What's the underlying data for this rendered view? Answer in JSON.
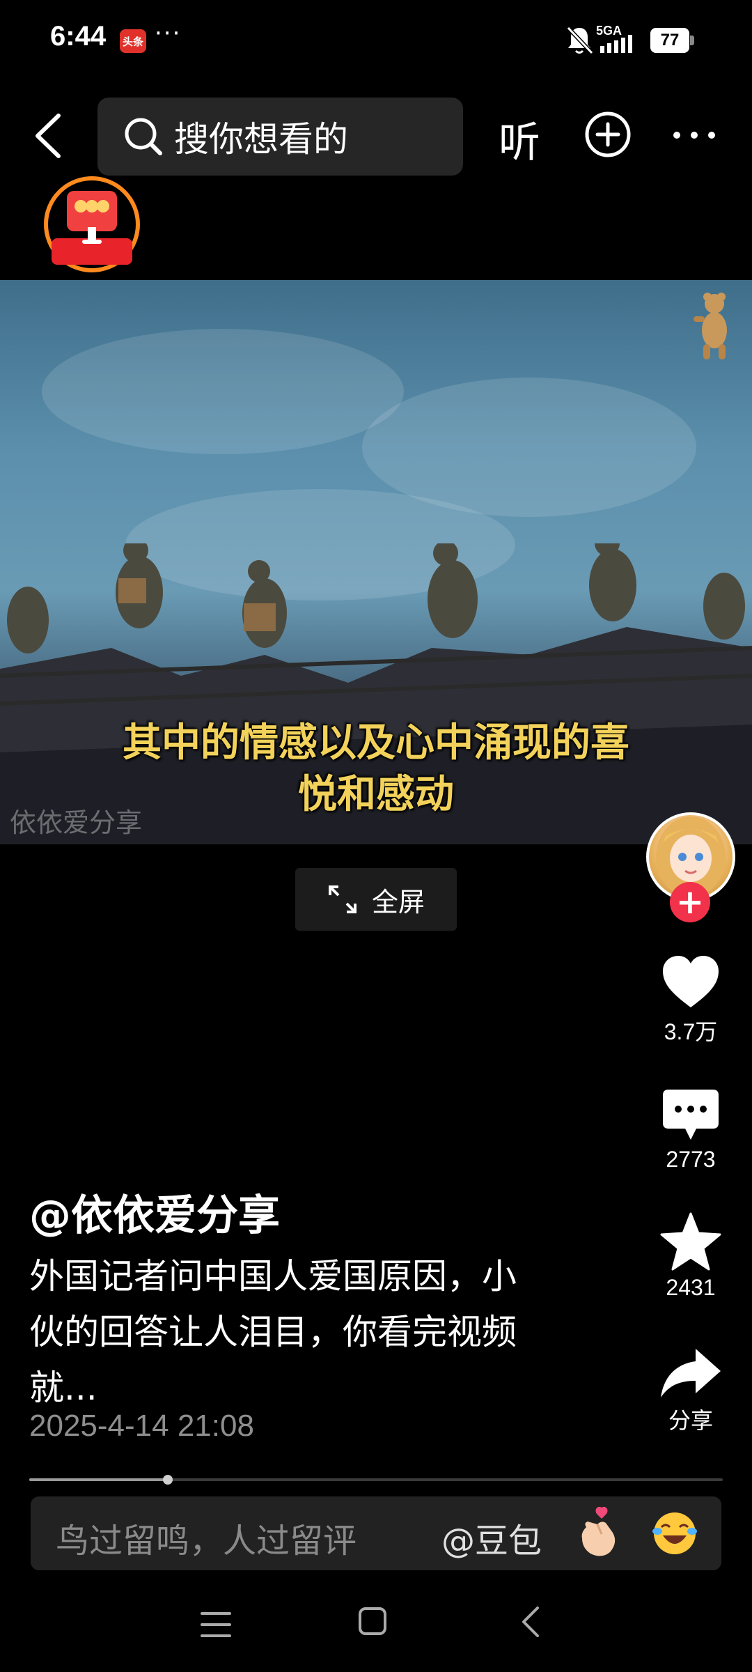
{
  "status_bar": {
    "time": "6:44",
    "app_badge": "头条",
    "overflow_dots": "···",
    "network": "5GA",
    "battery": "77"
  },
  "top_bar": {
    "search_placeholder": "搜你想看的",
    "listen_label": "听"
  },
  "video": {
    "subtitle_line1": "其中的情感以及心中涌现的喜",
    "subtitle_line2": "悦和感动",
    "watermark": "依依爱分享",
    "fullscreen_label": "全屏"
  },
  "actions": {
    "likes": "3.7万",
    "comments": "2773",
    "favorites": "2431",
    "share": "分享"
  },
  "post": {
    "author": "@依依爱分享",
    "caption_line1": "外国记者问中国人爱国原因，小",
    "caption_line2": "伙的回答让人泪目，你看完视频",
    "caption_line3": "就...",
    "time": "2025-4-14 21:08",
    "progress_fraction": 0.2
  },
  "comment_bar": {
    "placeholder": "鸟过留鸣，人过留评",
    "mention": "@豆包"
  },
  "icons": [
    "bell-off-icon",
    "signal-icon",
    "back-icon",
    "search-icon",
    "plus-circle-icon",
    "more-icon",
    "red-envelope-icon",
    "expand-icon",
    "heart-icon",
    "comment-icon",
    "star-icon",
    "share-icon",
    "heart-hand-emoji-icon",
    "laugh-cry-emoji-icon",
    "menu-icon",
    "home-icon",
    "nav-back-icon"
  ],
  "colors": {
    "background": "#000000",
    "subtitle": "#f2d25a",
    "follow": "#f2314a",
    "timestamp": "#8e8e8e"
  }
}
